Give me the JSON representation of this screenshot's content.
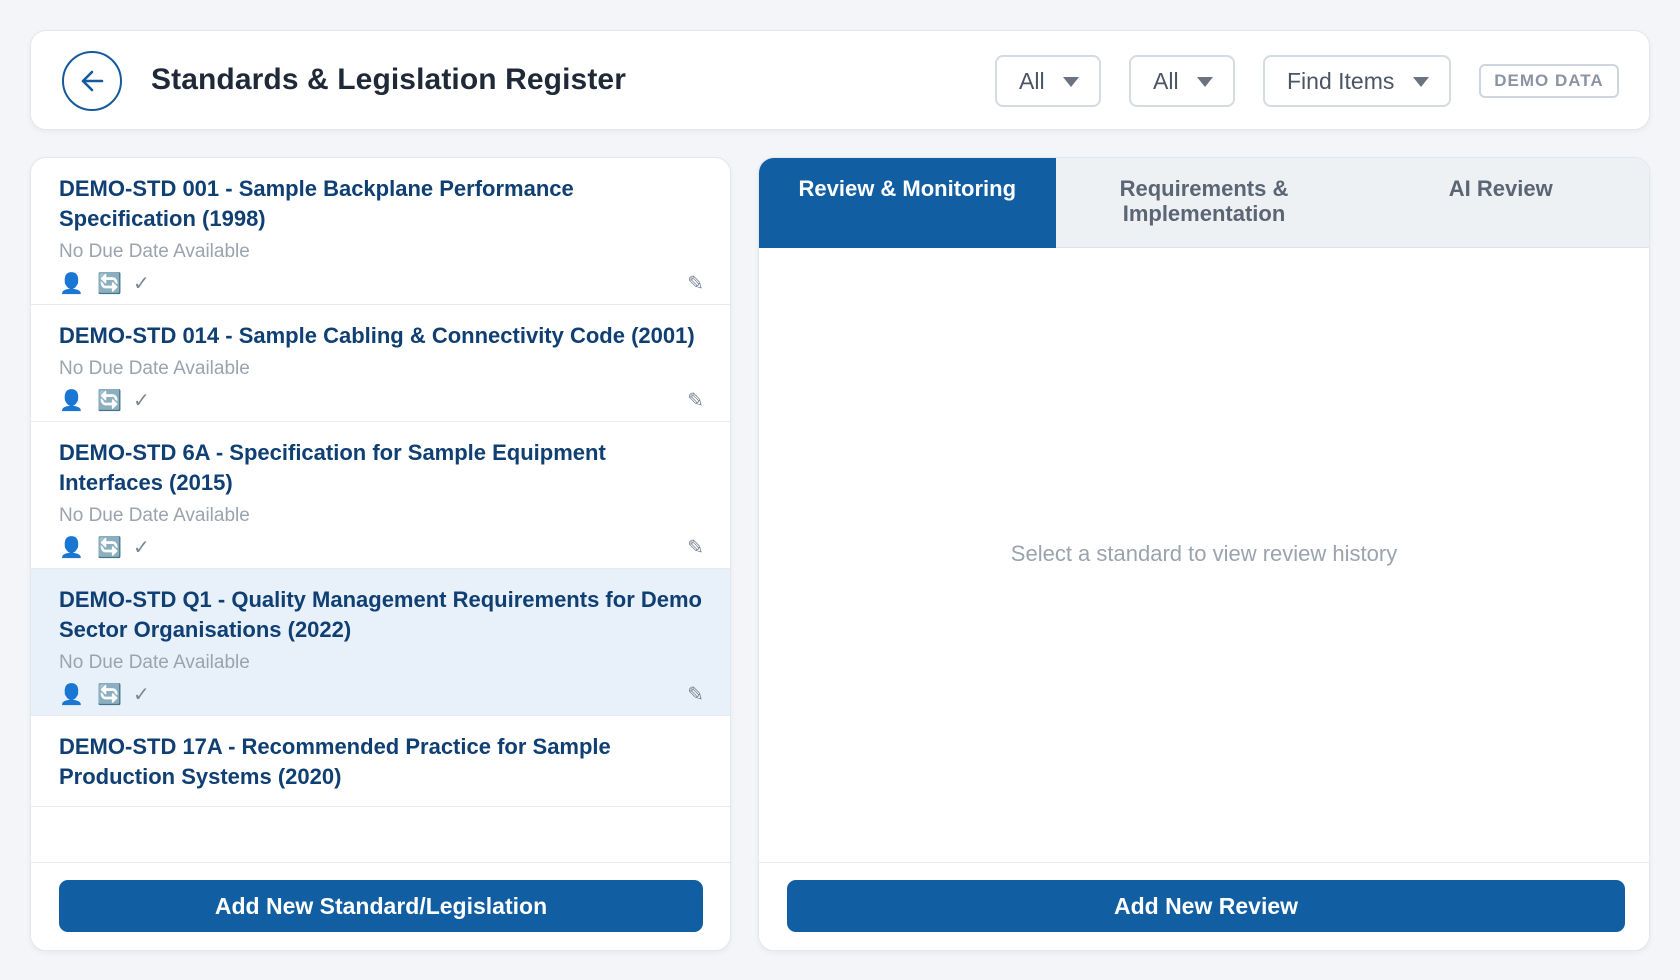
{
  "header": {
    "title": "Standards & Legislation Register",
    "filters": [
      {
        "selected": "All"
      },
      {
        "selected": "All"
      },
      {
        "selected": "Find Items"
      }
    ],
    "badge": "DEMO DATA"
  },
  "standards": [
    {
      "title": "DEMO-STD 001 - Sample Backplane Performance Specification (1998)",
      "due": "No Due Date Available",
      "selected": false
    },
    {
      "title": "DEMO-STD 014 - Sample Cabling & Connectivity Code (2001)",
      "due": "No Due Date Available",
      "selected": false
    },
    {
      "title": "DEMO-STD 6A - Specification for Sample Equipment Interfaces (2015)",
      "due": "No Due Date Available",
      "selected": false
    },
    {
      "title": "DEMO-STD Q1 - Quality Management Requirements for Demo Sector Organisations (2022)",
      "due": "No Due Date Available",
      "selected": true
    },
    {
      "title": "DEMO-STD 17A - Recommended Practice for Sample Production Systems (2020)",
      "due": "",
      "selected": false
    }
  ],
  "item_icons": {
    "user": "person-icon",
    "sync": "sync-icon",
    "check": "check-icon",
    "edit": "pencil-icon"
  },
  "left_footer": {
    "add_label": "Add New Standard/Legislation"
  },
  "tabs": [
    {
      "label": "Review & Monitoring",
      "active": true
    },
    {
      "label": "Requirements & Implementation",
      "active": false
    },
    {
      "label": "AI Review",
      "active": false
    }
  ],
  "right_panel": {
    "empty_message": "Select a standard to view review history"
  },
  "right_footer": {
    "add_label": "Add New Review"
  },
  "colors": {
    "primary": "#115ea3",
    "title_text": "#0f3f73",
    "selected_row": "#e8f0fa",
    "background": "#f3f5f8"
  }
}
